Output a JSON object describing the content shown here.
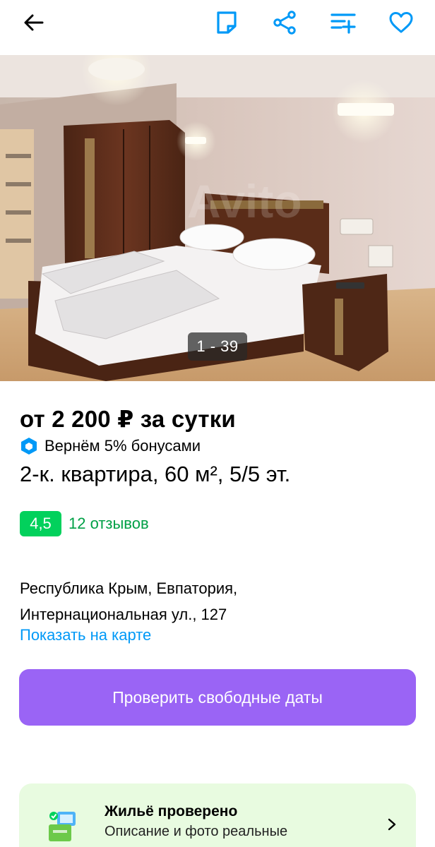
{
  "toolbar": {
    "back_icon": "arrow-left-icon",
    "note_icon": "note-icon",
    "share_icon": "share-icon",
    "compare_icon": "compare-list-icon",
    "favorite_icon": "heart-icon",
    "accent_color": "#0099f7"
  },
  "gallery": {
    "counter": "1 - 39",
    "watermark": "Avito"
  },
  "listing": {
    "price": "от 2 200 ₽ за сутки",
    "bonus": "Вернём 5% бонусами",
    "title": "2-к. квартира, 60 м², 5/5 эт."
  },
  "rating": {
    "score": "4,5",
    "reviews": "12 отзывов",
    "badge_color": "#02d15c"
  },
  "address": {
    "line1": "Республика Крым, Евпатория,",
    "line2": "Интернациональная ул., 127",
    "map_link": "Показать на карте"
  },
  "actions": {
    "check_dates": "Проверить свободные даты",
    "button_color": "#9a64f5"
  },
  "verified": {
    "title": "Жильё проверено",
    "subtitle": "Описание и фото реальные",
    "icon": "verified-house-icon",
    "background": "#e8fbe0"
  }
}
